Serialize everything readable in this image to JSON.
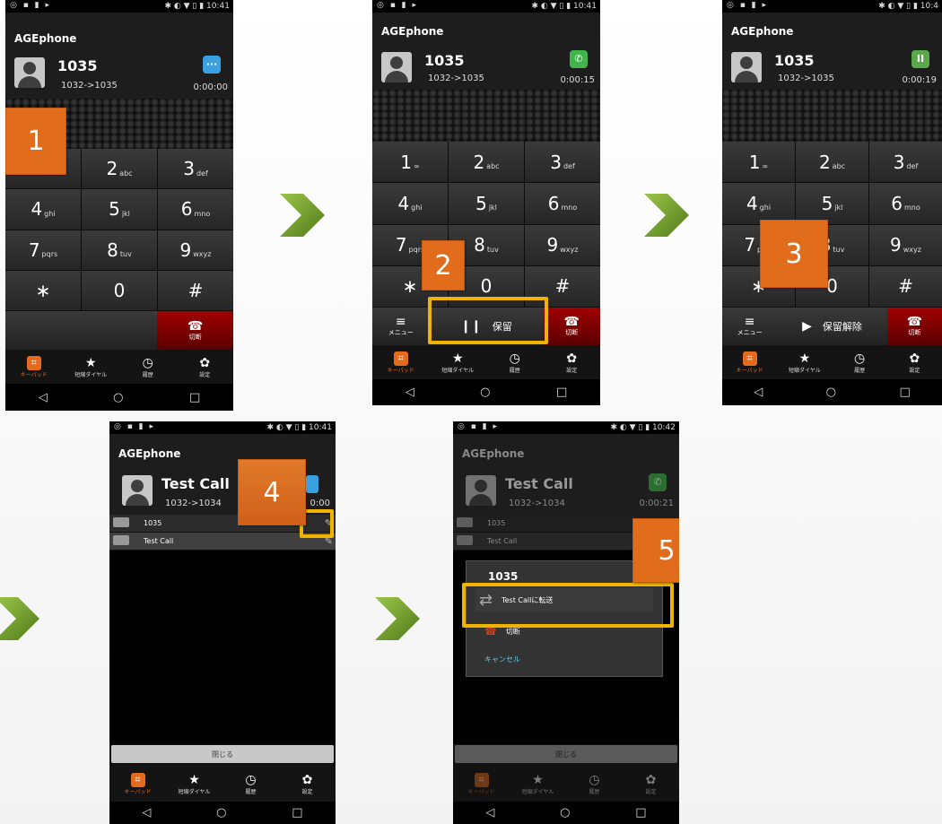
{
  "status_bar": {
    "left_icons": "◎ ▪ ▮ ▸",
    "right_a": "✱ ◐ ▼ ▯ ▮ 10:41",
    "right_b": "✱ ◐ ▼ ▯ ▮ 10:42",
    "right_c": "✱ ◐ ▼ ▯ ▮ 10:4"
  },
  "app": {
    "title": "AGEphone"
  },
  "call1": {
    "name": "1035",
    "route": "1032->1035",
    "time_a": "0:00:00",
    "time_b": "0:00:15",
    "time_c": "0:00:19",
    "icon_dots": "···",
    "icon_phone": "✆",
    "icon_pause": "II"
  },
  "call2": {
    "name": "Test Call",
    "route": "1032->1034",
    "time_a": "0:00",
    "time_b": "0:00:21"
  },
  "keypad": {
    "keys": [
      {
        "d": "1",
        "s": "∞"
      },
      {
        "d": "2",
        "s": "abc"
      },
      {
        "d": "3",
        "s": "def"
      },
      {
        "d": "4",
        "s": "ghi"
      },
      {
        "d": "5",
        "s": "jkl"
      },
      {
        "d": "6",
        "s": "mno"
      },
      {
        "d": "7",
        "s": "pqrs"
      },
      {
        "d": "8",
        "s": "tuv"
      },
      {
        "d": "9",
        "s": "wxyz"
      },
      {
        "d": "∗",
        "s": ""
      },
      {
        "d": "0",
        "s": ""
      },
      {
        "d": "#",
        "s": ""
      }
    ]
  },
  "actions": {
    "menu": "メニュー",
    "menu_icon": "≡",
    "hold": "保留",
    "hold_icon": "❙❙",
    "unhold": "保留解除",
    "unhold_icon": "▶",
    "hangup": "切断",
    "hangup_icon": "☎"
  },
  "tabs": [
    {
      "label": "キーパッド",
      "icon": "⌗"
    },
    {
      "label": "短縮ダイヤル",
      "icon": "★"
    },
    {
      "label": "履歴",
      "icon": "◷"
    },
    {
      "label": "設定",
      "icon": "✿"
    }
  ],
  "nav": {
    "back": "◁",
    "home": "○",
    "recent": "□"
  },
  "call_list": [
    {
      "name": "1035"
    },
    {
      "name": "Test Call"
    }
  ],
  "tool_icon": "✎",
  "close_label": "閉じる",
  "dialog": {
    "title": "1035",
    "transfer": "Test Callに転送",
    "transfer_icon": "⇄",
    "hangup": "切断",
    "cancel": "キャンセル"
  },
  "steps": [
    "1",
    "2",
    "3",
    "4",
    "5"
  ],
  "colors": {
    "badge": "#e06c1c",
    "highlight": "#f0b400",
    "arrow": "#6f9b2a",
    "tab_active": "#e46a1e"
  }
}
